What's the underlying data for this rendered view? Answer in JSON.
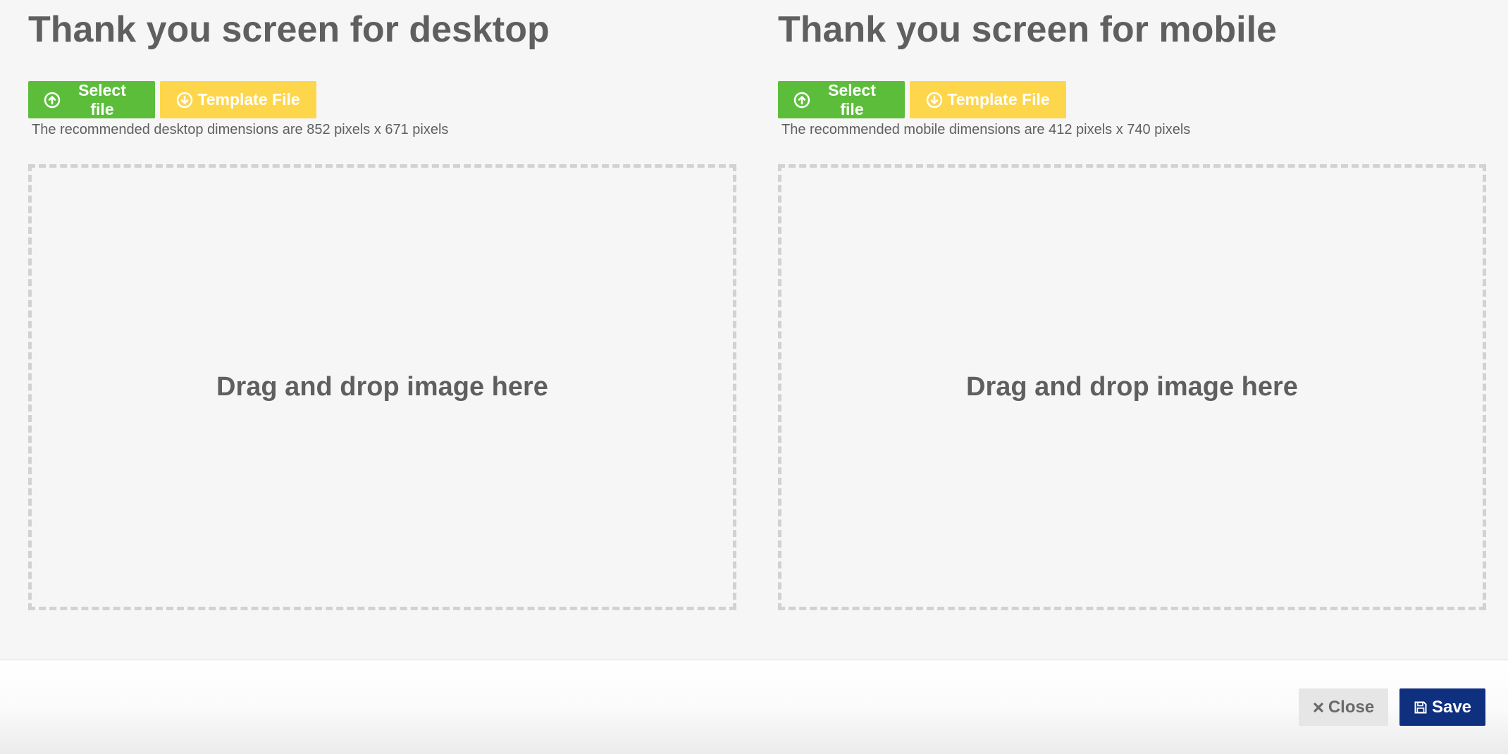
{
  "panels": {
    "desktop": {
      "title": "Thank you screen for desktop",
      "select_file_label": "Select file",
      "template_file_label": "Template File",
      "hint": "The recommended desktop dimensions are 852 pixels x 671 pixels",
      "dropzone_text": "Drag and drop image here"
    },
    "mobile": {
      "title": "Thank you screen for mobile",
      "select_file_label": "Select file",
      "template_file_label": "Template File",
      "hint": "The recommended mobile dimensions are 412 pixels x 740 pixels",
      "dropzone_text": "Drag and drop image here"
    }
  },
  "footer": {
    "close_label": "Close",
    "save_label": "Save"
  },
  "icons": {
    "select_file": "upload-circle-icon",
    "template_file": "download-circle-icon",
    "close": "close-x-icon",
    "save": "floppy-disk-icon"
  },
  "colors": {
    "select_button": "#5cbd3b",
    "template_button": "#fdd64c",
    "save_button": "#0f2f7f",
    "close_button": "#e6e6e6",
    "background": "#f6f6f6",
    "dropzone_border": "#d2d2d2"
  }
}
